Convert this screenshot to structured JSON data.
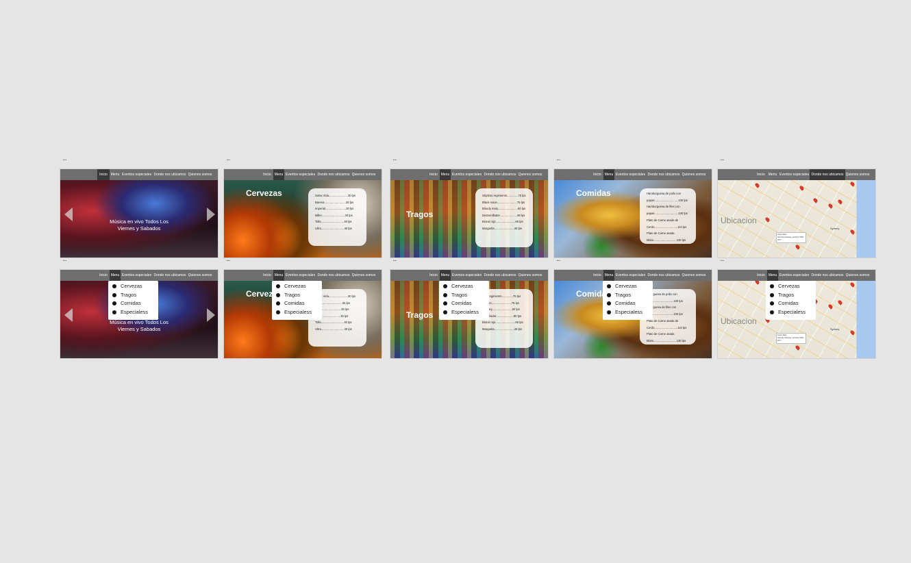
{
  "nav": [
    "Inicio",
    "Menu",
    "Eventos especiales",
    "Donde nos ubicamos",
    "Quienes somos"
  ],
  "ellipsis": "...",
  "home": {
    "caption_line1": "Música en vivo Todos Los",
    "caption_line2": "Viernes y Sabados"
  },
  "cervezas": {
    "title": "Cervezas",
    "items": [
      "Salva Vida........................30 lps",
      "Barena...........................35 lps",
      "Imperial..........................30 lps",
      "Miller.............................30 lps",
      "Tolla.............................40 lps",
      "Ultra.............................40 lps"
    ],
    "items_under_menu": [
      "Salva Vida........................30 lps",
      "rena...........................35 lps",
      "erial..........................30 lps",
      "er.............................30 lps",
      "Tolla.............................40 lps",
      "Ultra.............................40 lps"
    ]
  },
  "tragos": {
    "title": "Tragos",
    "items": [
      "Séptimo regimiento..............75 lps",
      "Black moon.........................75 lps",
      "Bloody mary.........................60 lps",
      "Destornillador......................80 lps",
      "Brand rojo.........................65 lps",
      "Margarita.........................48 lps"
    ],
    "items_under_menu": [
      "timo regimiento..............75 lps",
      "k moon.........................75 lps",
      "dy mary.........................60 lps",
      "stornillador......................80 lps",
      "Brand rojo.........................65 lps",
      "Margarita.........................48 lps"
    ]
  },
  "comidas": {
    "title": "Comidas",
    "items": [
      "Hamburguesa de pollo con",
      "papas..............................100 lps",
      "Hamburguesa de files con",
      "papas..............................100 lps",
      "Plato de Carne asada de",
      "Cerdo.............................110 lps",
      "Plato de Carne asada",
      "Mixto.............................130 lps"
    ],
    "items_under_menu": [
      "mburguesa de pollo con",
      "as..............................100 lps",
      "mburguesa de files con",
      "as..............................100 lps",
      "Plato de Carne asada de",
      "Cerdo.............................110 lps",
      "Plato de Carne asada",
      "Mixto.............................130 lps"
    ]
  },
  "ubicacion": {
    "title": "Ubicacion",
    "city": "Sydney",
    "label_line1": "Green Dale",
    "label_line2": "Hornsby Parkway, Hornsby NSW 2077"
  },
  "dropdown": [
    "Cervezas",
    "Tragos",
    "Comidas",
    "Especialess"
  ],
  "colors": {
    "background": "#e5e5e5",
    "nav": "#6e6e6e",
    "nav_active": "#3a3a3a",
    "pin": "#d23a2a"
  }
}
